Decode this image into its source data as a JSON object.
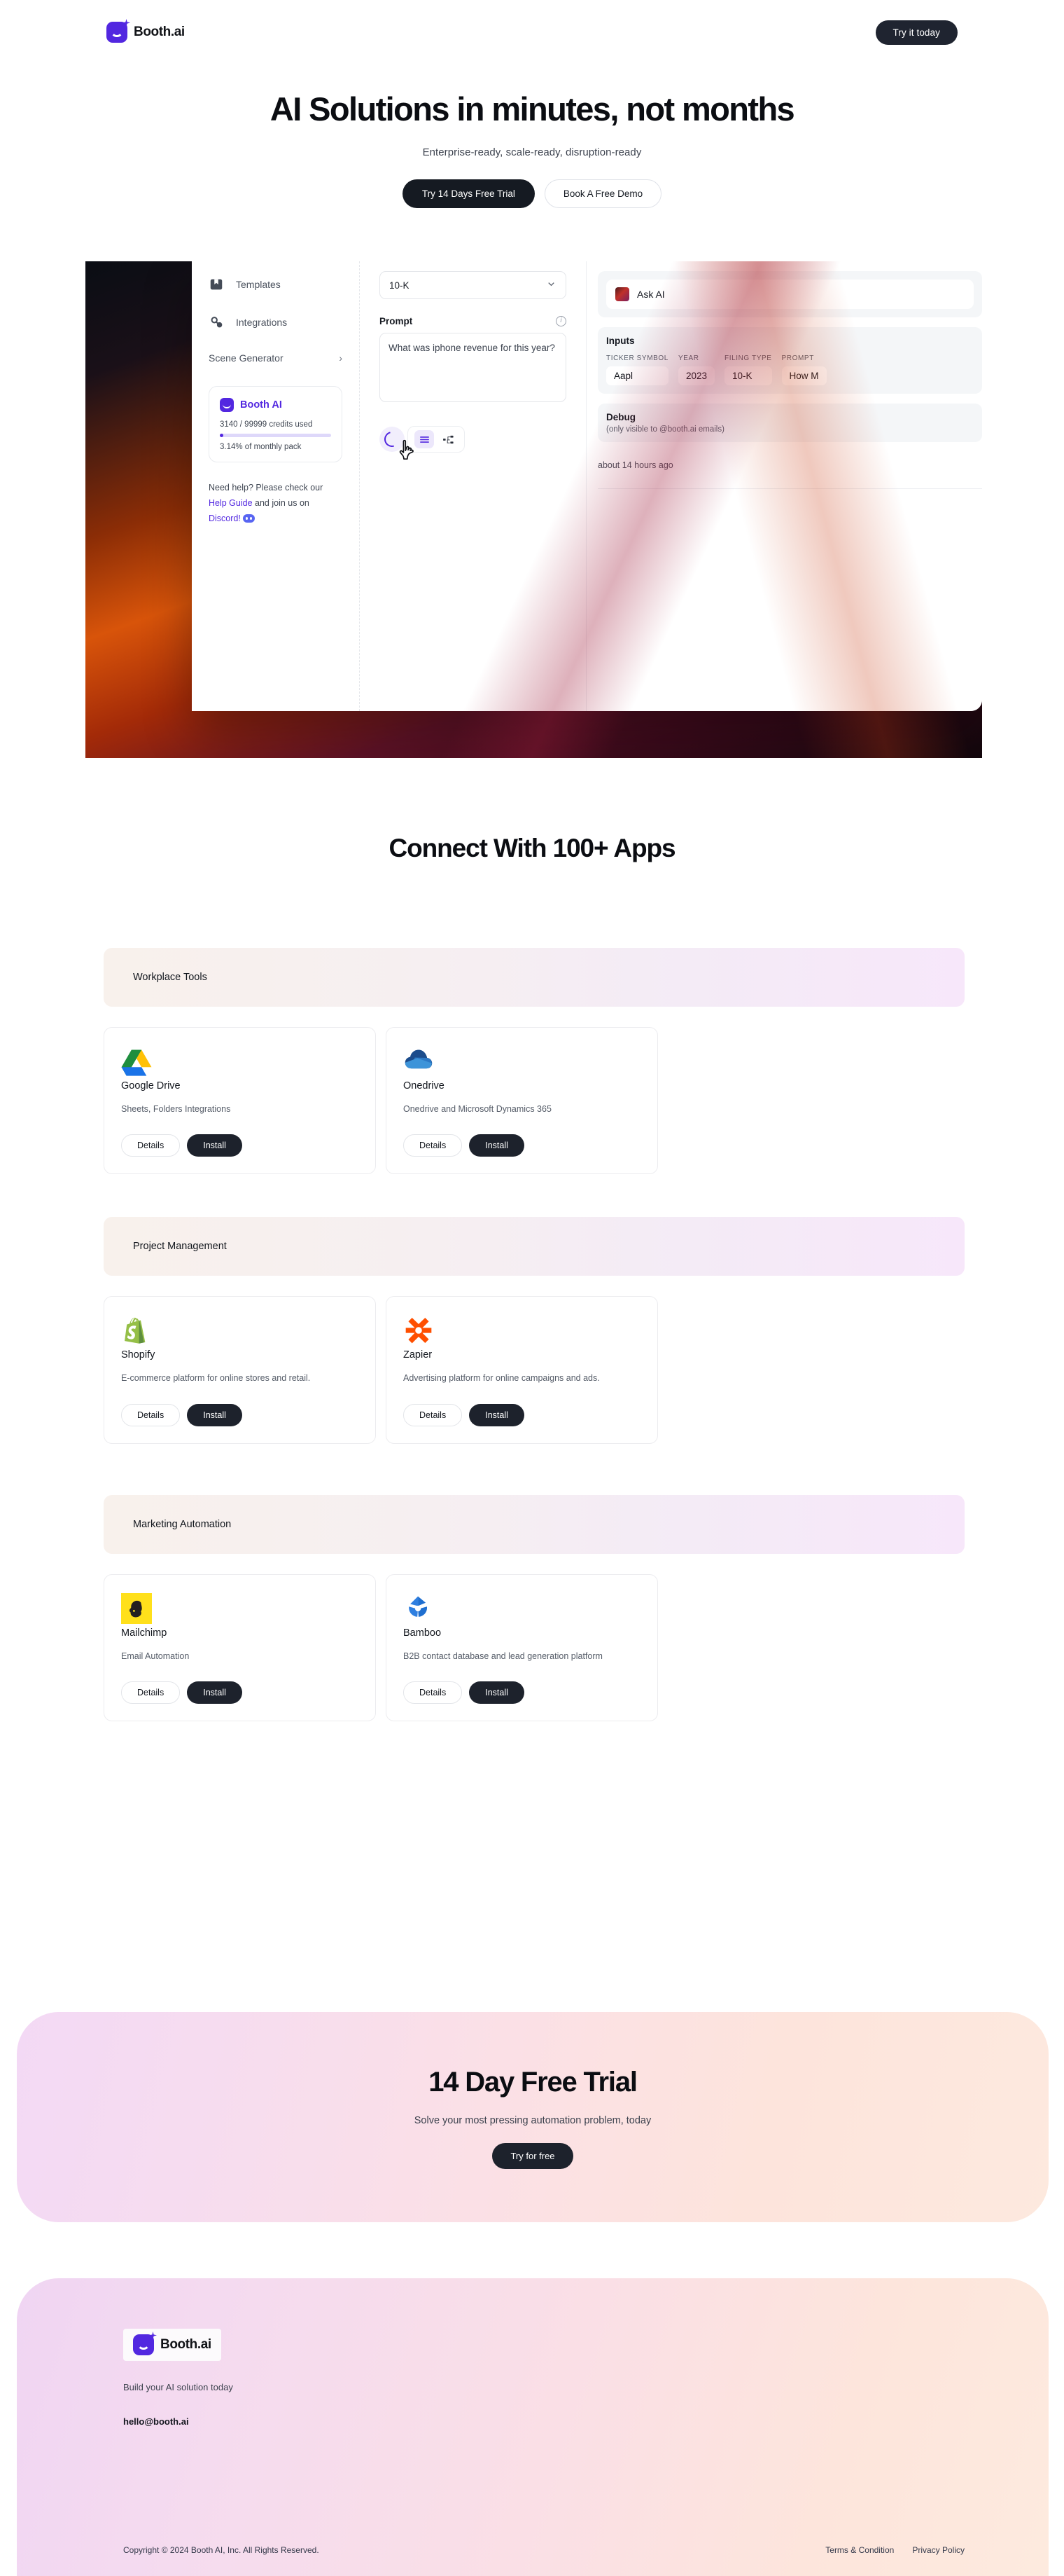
{
  "brand": {
    "name": "Booth.ai",
    "logo_icon": "booth-smile-logo",
    "accent": "#5227e0"
  },
  "header": {
    "cta_label": "Try it today"
  },
  "hero": {
    "title": "AI Solutions in minutes, not months",
    "subtitle": "Enterprise-ready, scale-ready, disruption-ready",
    "primary_cta": "Try 14 Days Free Trial",
    "secondary_cta": "Book A Free Demo"
  },
  "product_shot": {
    "sidebar": {
      "items": [
        {
          "label": "Templates",
          "icon": "templates-icon"
        },
        {
          "label": "Integrations",
          "icon": "integrations-icon"
        }
      ],
      "expandable": {
        "label": "Scene Generator",
        "icon": "chevron-right-icon"
      },
      "credits": {
        "app_name": "Booth AI",
        "usage": "3140 / 99999 credits used",
        "percent_label": "3.14% of monthly pack",
        "percent_value": 3.14
      },
      "help": {
        "line1": "Need help? Please check our",
        "link1": "Help Guide",
        "mid": "and join us on",
        "link2": "Discord!",
        "icon": "discord-icon"
      }
    },
    "middle": {
      "filing_select_value": "10-K",
      "prompt_label": "Prompt",
      "prompt_info_icon": "info-icon",
      "prompt_value": "What was iphone revenue for this year?",
      "toolbar": {
        "spinner": "loading-spinner",
        "view_list_icon": "list-view-icon",
        "view_tree_icon": "tree-view-icon"
      }
    },
    "right": {
      "ask_ai_label": "Ask AI",
      "inputs_title": "Inputs",
      "inputs": [
        {
          "label": "TICKER SYMBOL",
          "value": "Aapl"
        },
        {
          "label": "YEAR",
          "value": "2023"
        },
        {
          "label": "FILING TYPE",
          "value": "10-K"
        },
        {
          "label": "PROMPT",
          "value": "How M"
        }
      ],
      "debug_title": "Debug",
      "debug_sub": "(only visible to @booth.ai emails)",
      "timestamp": "about 14 hours ago"
    }
  },
  "apps": {
    "heading": "Connect With 100+ Apps",
    "details_label": "Details",
    "install_label": "Install",
    "categories": [
      {
        "name": "Workplace Tools",
        "items": [
          {
            "name": "Google Drive",
            "desc": "Sheets, Folders Integrations",
            "icon": "google-drive-icon"
          },
          {
            "name": "Onedrive",
            "desc": "Onedrive and Microsoft Dynamics 365",
            "icon": "onedrive-icon"
          }
        ]
      },
      {
        "name": "Project Management",
        "items": [
          {
            "name": "Shopify",
            "desc": "E-commerce platform for online stores and retail.",
            "icon": "shopify-icon"
          },
          {
            "name": "Zapier",
            "desc": "Advertising platform for online campaigns and ads.",
            "icon": "zapier-icon"
          }
        ]
      },
      {
        "name": "Marketing Automation",
        "items": [
          {
            "name": "Mailchimp",
            "desc": "Email Automation",
            "icon": "mailchimp-icon"
          },
          {
            "name": "Bamboo",
            "desc": "B2B contact database and lead generation platform",
            "icon": "bamboo-icon"
          }
        ]
      }
    ]
  },
  "cta": {
    "title": "14 Day Free Trial",
    "subtitle": "Solve your most pressing automation problem, today",
    "button": "Try for free"
  },
  "footer": {
    "tagline": "Build your AI solution today",
    "email": "hello@booth.ai",
    "copyright": "Copyright © 2024 Booth AI, Inc. All Rights Reserved.",
    "links": [
      {
        "label": "Terms & Condition"
      },
      {
        "label": "Privacy Policy"
      }
    ]
  }
}
